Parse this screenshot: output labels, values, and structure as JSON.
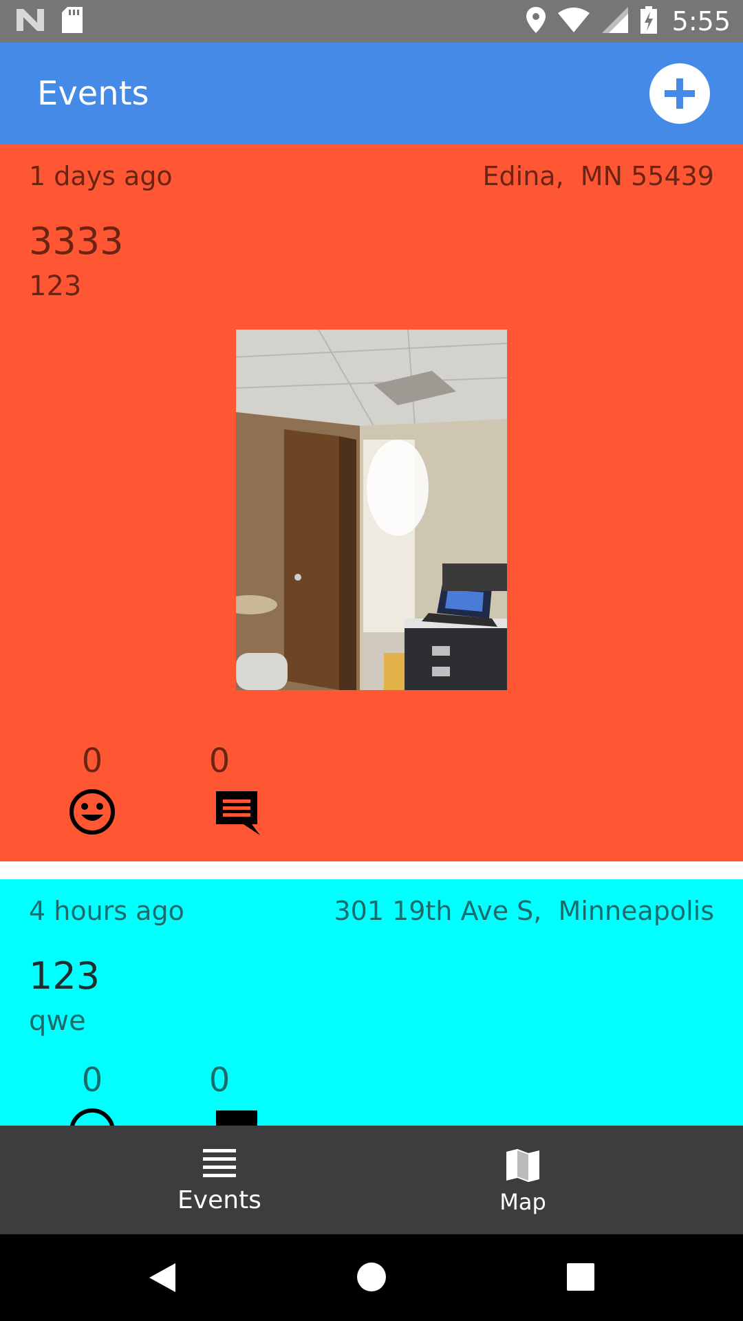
{
  "status_bar": {
    "time": "5:55",
    "left_icons": [
      "n-logo-icon",
      "sd-card-icon"
    ],
    "right_icons": [
      "location-pin-icon",
      "wifi-icon",
      "cell-signal-icon",
      "battery-charging-icon"
    ]
  },
  "app_bar": {
    "title": "Events",
    "add_icon": "plus-circle-icon",
    "color": "#448ae6"
  },
  "events": [
    {
      "time_ago": "1 days ago",
      "location": "Edina,  MN 55439",
      "title": "3333",
      "description": "123",
      "has_photo": true,
      "reactions": "0",
      "comments": "0",
      "color": "#ff5733"
    },
    {
      "time_ago": "4 hours ago",
      "location": "301 19th Ave S,  Minneapolis",
      "title": "123",
      "description": "qwe",
      "has_photo": false,
      "reactions": "0",
      "comments": "0",
      "color": "#00ffff"
    }
  ],
  "bottom_nav": {
    "items": [
      {
        "label": "Events",
        "icon": "list-icon",
        "active": true
      },
      {
        "label": "Map",
        "icon": "map-icon",
        "active": false
      }
    ]
  },
  "system_nav": {
    "icons": [
      "back-icon",
      "home-icon",
      "recents-icon"
    ]
  }
}
